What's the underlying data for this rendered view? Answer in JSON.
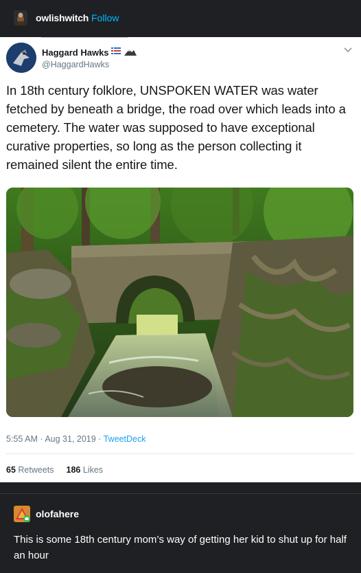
{
  "post": {
    "username": "owlishwitch",
    "follow_label": "Follow"
  },
  "tweet": {
    "display_name": "Haggard Hawks",
    "handle": "@HaggardHawks",
    "text": "In 18th century folklore, UNSPOKEN WATER was water fetched by beneath a bridge, the road over which leads into a cemetery. The water was supposed to have exceptional curative properties, so long as the person collecting it remained silent the entire time.",
    "time": "5:55 AM",
    "date": "Aug 31, 2019",
    "separator": "·",
    "source": "TweetDeck",
    "retweets_count": "65",
    "retweets_label": "Retweets",
    "likes_count": "186",
    "likes_label": "Likes"
  },
  "reblog": {
    "username": "olofahere",
    "text": "This is some 18th century mom’s way of getting her kid to shut up for half an hour"
  },
  "colors": {
    "dark_bg": "#1f2023",
    "follow_blue": "#00b8ff",
    "twitter_blue": "#1da1f2",
    "muted_text": "#657786"
  }
}
